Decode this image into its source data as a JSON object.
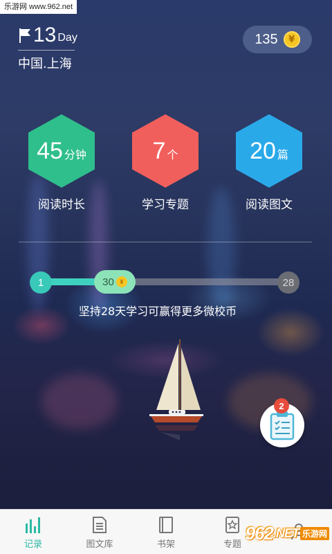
{
  "watermark": {
    "top_text": "乐游网 www.962.net",
    "bottom_logo": "962",
    "bottom_suffix": ".NET",
    "bottom_sub": "乐游网"
  },
  "header": {
    "day_number": "13",
    "day_unit": "Day",
    "location": "中国.上海",
    "coins": "135",
    "coin_symbol": "¥"
  },
  "stats": [
    {
      "value": "45",
      "unit": "分钟",
      "label": "阅读时长",
      "color": "#2fbf8c"
    },
    {
      "value": "7",
      "unit": "个",
      "label": "学习专题",
      "color": "#f15f5c"
    },
    {
      "value": "20",
      "unit": "篇",
      "label": "阅读图文",
      "color": "#2aa9e8"
    }
  ],
  "progress": {
    "start": "1",
    "current": "30",
    "end": "28",
    "fraction_filled": 0.3,
    "coin_symbol": "¥",
    "message": "坚持28天学习可赢得更多微校币"
  },
  "float_button": {
    "badge": "2"
  },
  "bottom_nav": {
    "items": [
      {
        "label": "记录",
        "icon": "bar-chart-icon",
        "active": true
      },
      {
        "label": "图文库",
        "icon": "document-icon",
        "active": false
      },
      {
        "label": "书架",
        "icon": "book-icon",
        "active": false
      },
      {
        "label": "专题",
        "icon": "star-card-icon",
        "active": false
      },
      {
        "label": "",
        "icon": "person-icon",
        "active": false
      }
    ]
  },
  "colors": {
    "accent": "#2cb8a3",
    "progress_fill": "#3fd1c0",
    "coin": "#f6c623",
    "badge": "#e74c3c"
  }
}
